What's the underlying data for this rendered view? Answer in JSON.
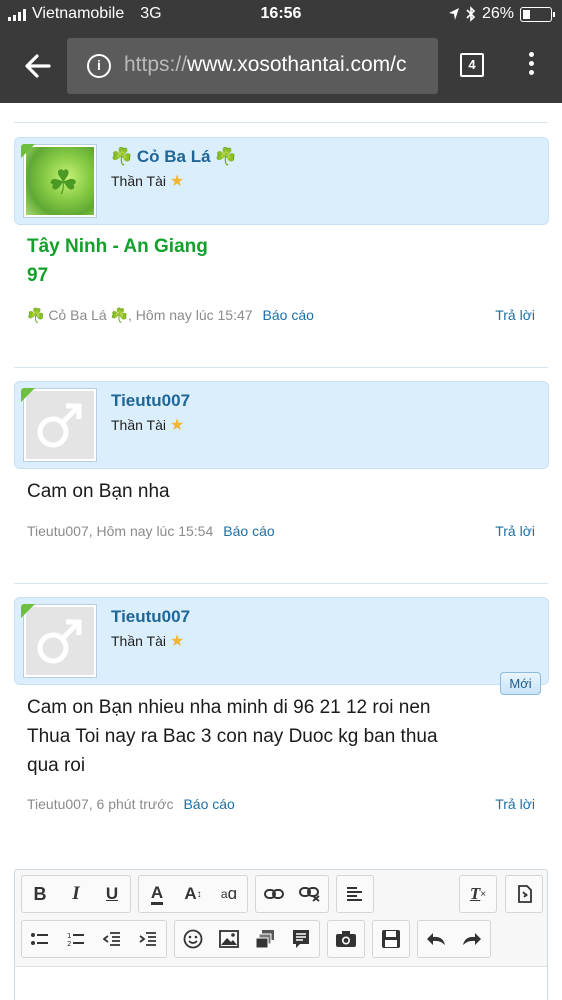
{
  "status_bar": {
    "carrier": "Vietnamobile",
    "network": "3G",
    "time": "16:56",
    "battery": "26%",
    "battery_level": 0.26
  },
  "browser": {
    "url_scheme": "https://",
    "url_host": "www.xosothantai.com/c",
    "tab_count": "4"
  },
  "posts": [
    {
      "username": "☘️ Cỏ Ba Lá ☘️",
      "rank": "Thần Tài",
      "message_lines": [
        "Tây Ninh - An Giang",
        "97"
      ],
      "meta": "☘️ Cỏ Ba Lá ☘️, Hôm nay lúc 15:47",
      "report": "Báo cáo",
      "reply": "Trả lời"
    },
    {
      "username": "Tieutu007",
      "rank": "Thần Tài",
      "message_lines": [
        "Cam on Bạn nha"
      ],
      "meta": "Tieutu007, Hôm nay lúc 15:54",
      "report": "Báo cáo",
      "reply": "Trả lời"
    },
    {
      "username": "Tieutu007",
      "rank": "Thần Tài",
      "badge": "Mới",
      "message_lines": [
        "Cam on Bạn nhieu nha minh di 96 21 12 roi nen",
        "Thua Toi nay ra Bac 3 con nay Duoc kg ban thua",
        "qua roi"
      ],
      "meta": "Tieutu007, 6 phút trước",
      "report": "Báo cáo",
      "reply": "Trả lời"
    }
  ],
  "editor": {
    "bold": "B",
    "italic": "I",
    "underline": "U",
    "font_color": "A",
    "font_size": "A",
    "font_family": "a"
  },
  "colors": {
    "chrome_bg": "#3a3a3a",
    "user_block_bg": "#dbeefc",
    "username": "#1f6698",
    "green_message": "#12a12a",
    "link": "#1d6fa5"
  }
}
